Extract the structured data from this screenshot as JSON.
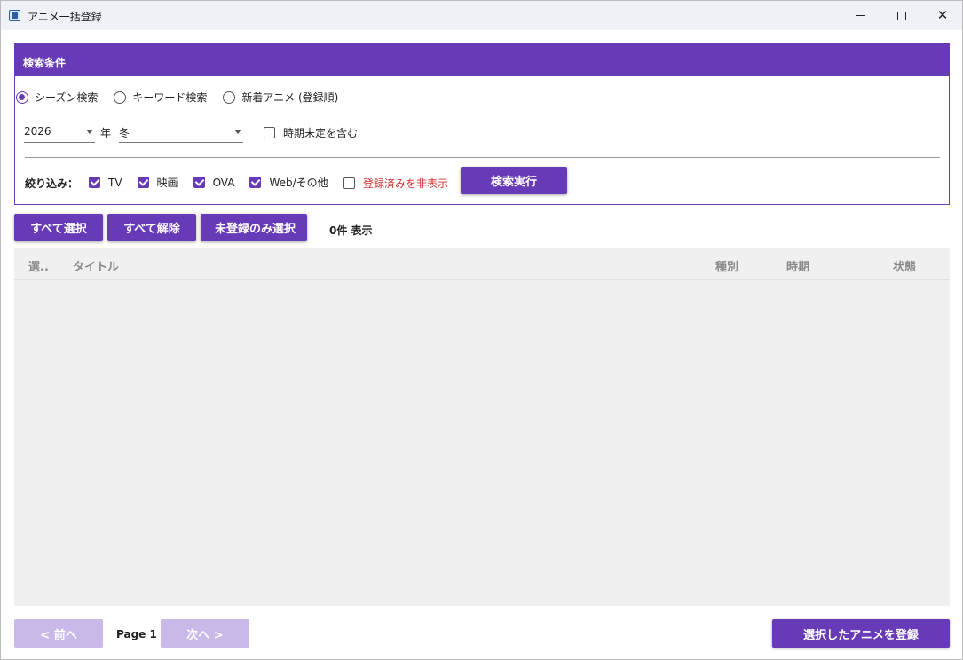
{
  "window": {
    "title": "アニメ一括登録"
  },
  "search": {
    "header": "検索条件",
    "modes": [
      {
        "label": "シーズン検索",
        "checked": true
      },
      {
        "label": "キーワード検索",
        "checked": false
      },
      {
        "label": "新着アニメ (登録順)",
        "checked": false
      }
    ],
    "year_value": "2026",
    "year_unit": "年",
    "season_value": "冬",
    "include_undated_label": "時期未定を含む",
    "filter_label": "絞り込み：",
    "filters": [
      {
        "label": "TV",
        "checked": true
      },
      {
        "label": "映画",
        "checked": true
      },
      {
        "label": "OVA",
        "checked": true
      },
      {
        "label": "Web/その他",
        "checked": true
      }
    ],
    "hide_registered_label": "登録済みを非表示",
    "execute_label": "検索実行"
  },
  "selection": {
    "select_all": "すべて選択",
    "deselect_all": "すべて解除",
    "select_unregistered": "未登録のみ選択",
    "count_text": "0件 表示"
  },
  "list": {
    "columns": [
      "選..",
      "タイトル",
      "種別",
      "時期",
      "状態"
    ],
    "rows": []
  },
  "footer": {
    "prev": "< 前へ",
    "page": "Page 1",
    "next": "次へ >",
    "register": "選択したアニメを登録"
  },
  "colors": {
    "accent": "#673ab7",
    "disabled": "#c9b9e9",
    "warning_text": "#d32f2f"
  }
}
